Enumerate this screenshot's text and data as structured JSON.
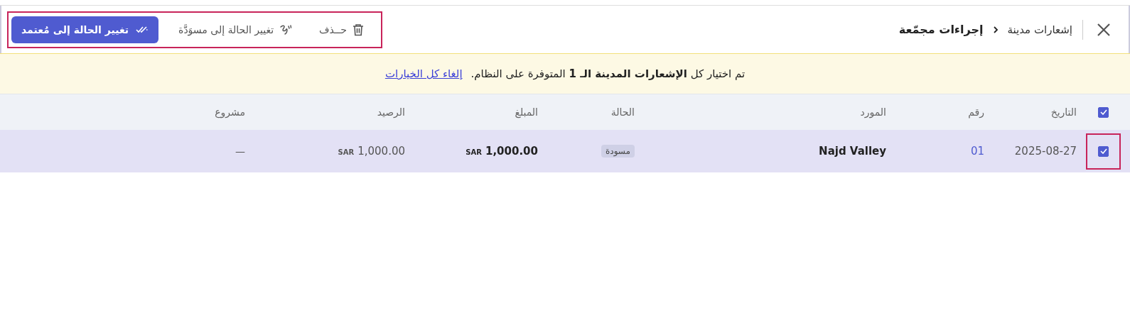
{
  "header": {
    "breadcrumb": [
      {
        "label": "إشعارات مدينة"
      },
      {
        "label": "إجراءات مجمّعة"
      }
    ],
    "actions": [
      {
        "kind": "delete",
        "label": "حــذف"
      },
      {
        "kind": "draft",
        "label": "تغيير الحالة إلى مسوَدَّة"
      },
      {
        "kind": "primary",
        "label": "تغيير الحالة إلى مُعتمد"
      }
    ],
    "actions_highlighted": true
  },
  "banner": {
    "message": "تم اختيار كل **الإشعارات المدينة الـ 1** المتوفرة على النظام.",
    "link": "إلغاء كل الخيارات"
  },
  "table": {
    "select_all_checked": true,
    "columns": [
      "التاريخ",
      "رقم",
      "المورد",
      "الحالة",
      "المبلغ",
      "الرصيد",
      "مشروع"
    ],
    "rows": [
      {
        "selected": true,
        "highlighted": true,
        "date": "2025-08-27",
        "number": "01",
        "supplier": "Najd Valley",
        "status": "مسودة",
        "amount": "1,000.00",
        "amount_currency": "SAR",
        "balance": "1,000.00",
        "balance_currency": "SAR",
        "project": "—"
      }
    ]
  }
}
